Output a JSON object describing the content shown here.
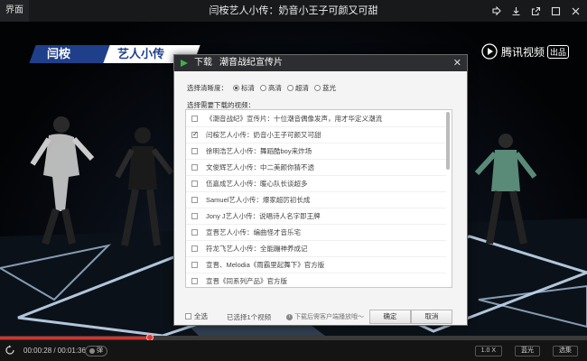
{
  "titlebar": {
    "left_label": "界面",
    "title": "闫桉艺人小传：奶音小王子可颜又可甜",
    "icons": [
      "share-icon",
      "download-icon",
      "external-icon",
      "restore-icon",
      "close-icon"
    ]
  },
  "video": {
    "banner_left": "闫桉",
    "banner_right": "艺人小传",
    "watermark": "腾讯视频",
    "watermark_badge": "出品"
  },
  "dialog": {
    "header_label": "下载",
    "header_title": "潮音战纪宣传片",
    "close": "✕",
    "quality_label": "选择清晰度：",
    "quality_options": [
      {
        "label": "标清",
        "selected": true
      },
      {
        "label": "高清",
        "selected": false
      },
      {
        "label": "超清",
        "selected": false
      },
      {
        "label": "蓝光",
        "selected": false
      }
    ],
    "list_label": "选择需要下载的视频：",
    "items": [
      {
        "title": "《潮音战纪》宣传片：十位潮音偶像发声，用才华定义潮流",
        "checked": false
      },
      {
        "title": "闫桉艺人小传：奶音小王子可颜又可甜",
        "checked": true
      },
      {
        "title": "徐明浩艺人小传：舞蹈酷boy来炸场",
        "checked": false
      },
      {
        "title": "文俊辉艺人小传：中二美颜你猜不透",
        "checked": false
      },
      {
        "title": "伍嘉成艺人小传：暖心队长谈超多",
        "checked": false
      },
      {
        "title": "Samuel艺人小传：爆家超厉初长成",
        "checked": false
      },
      {
        "title": "Jony J艺人小传：说唱诗人名字即王牌",
        "checked": false
      },
      {
        "title": "宣晋艺人小传：编曲怪才音乐宅",
        "checked": false
      },
      {
        "title": "符龙飞艺人小传：全能蹦神养成记",
        "checked": false
      },
      {
        "title": "宣晋、Melodia《雨霸里起舞下》官方版",
        "checked": false
      },
      {
        "title": "宣晋《同系列产品》官方版",
        "checked": false
      }
    ],
    "footer": {
      "select_all": "全选",
      "count": "已选择1个视频",
      "hint": "下载后需客户端播放哦～",
      "ok": "确定",
      "cancel": "取消"
    }
  },
  "player": {
    "progress_fraction": 0.255,
    "time": "00:00:28 / 00:01:36",
    "danmu": "弹",
    "speed": "1.0 X",
    "quality": "蓝光",
    "episodes": "选集"
  }
}
